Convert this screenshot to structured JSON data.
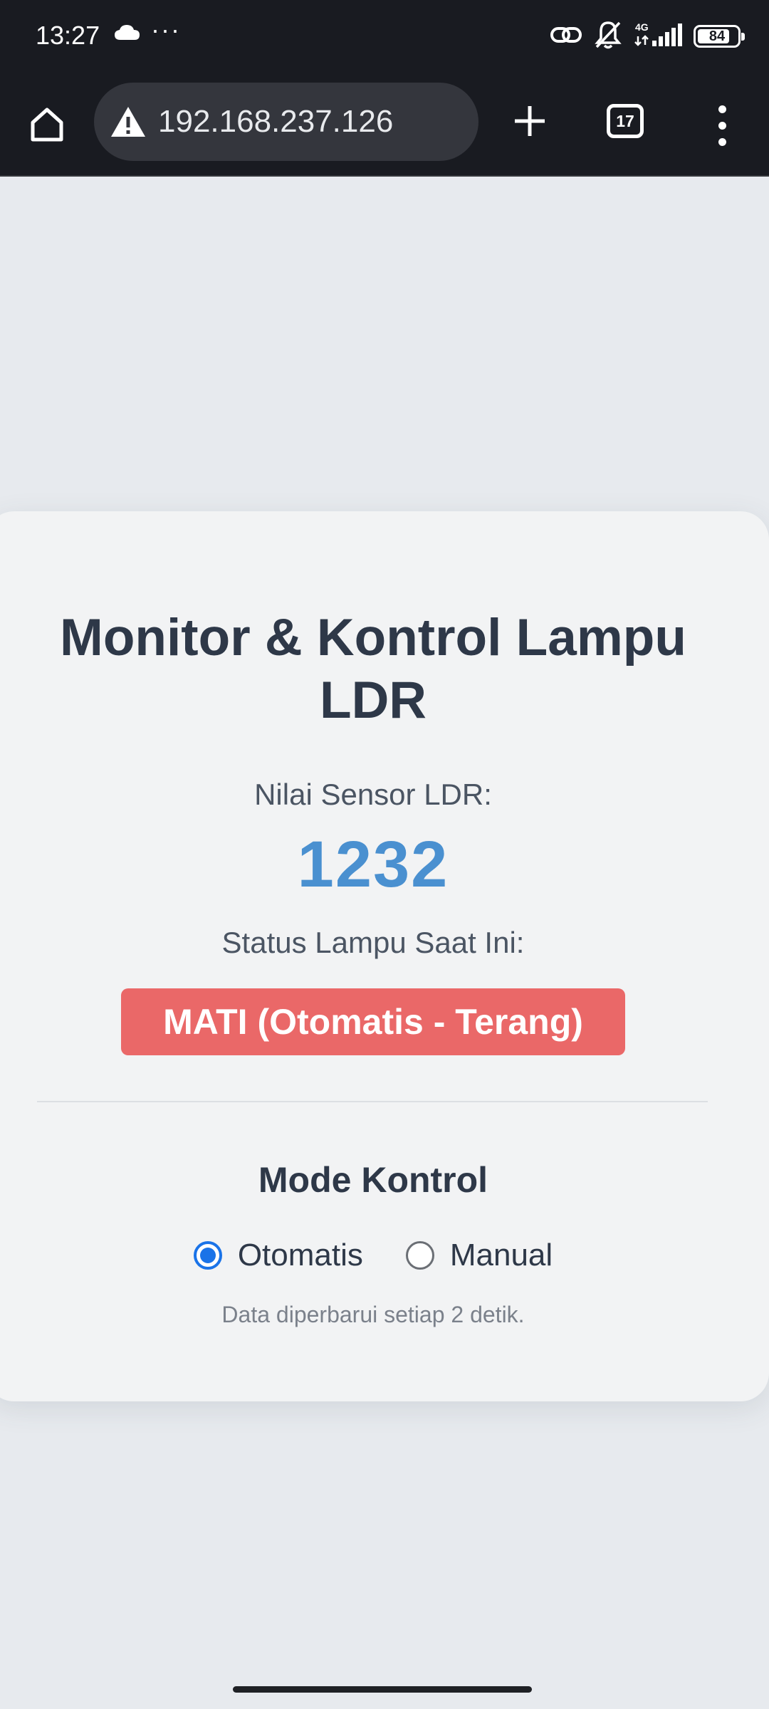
{
  "status_bar": {
    "time": "13:27",
    "more_indicator": "···",
    "network_type": "4G",
    "battery_level": "84",
    "icons": [
      "cloud-icon",
      "link-icon",
      "muted-bell-icon",
      "signal-icon",
      "battery-icon"
    ]
  },
  "browser": {
    "url": "192.168.237.126",
    "security_state": "not-secure-warning-icon",
    "tab_count": "17",
    "icons": [
      "home-icon",
      "plus-icon",
      "tabs-icon",
      "more-vert-icon"
    ],
    "theme_color": "#191b21"
  },
  "card": {
    "title": "Monitor & Kontrol Lampu LDR",
    "sensor_label": "Nilai Sensor LDR:",
    "sensor_value": "1232",
    "sensor_value_color": "#4a90d0",
    "status_label": "Status Lampu Saat Ini:",
    "status_text": "MATI (Otomatis - Terang)",
    "status_color": "#ea6868"
  },
  "mode": {
    "title": "Mode Kontrol",
    "options": [
      {
        "label": "Otomatis",
        "checked": true
      },
      {
        "label": "Manual",
        "checked": false
      }
    ],
    "accent_color": "#1a73e8"
  },
  "footer_note": "Data diperbarui setiap 2 detik."
}
